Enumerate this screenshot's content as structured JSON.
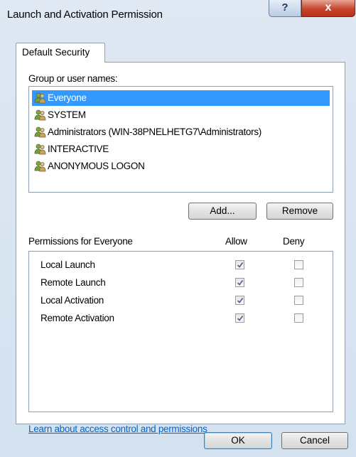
{
  "window": {
    "title": "Launch and Activation Permission",
    "help_label": "?",
    "close_label": "x"
  },
  "tab": {
    "label": "Default Security"
  },
  "users": {
    "label": "Group or user names:",
    "items": [
      {
        "name": "Everyone",
        "selected": true
      },
      {
        "name": "SYSTEM",
        "selected": false
      },
      {
        "name": "Administrators (WIN-38PNELHETG7\\Administrators)",
        "selected": false
      },
      {
        "name": "INTERACTIVE",
        "selected": false
      },
      {
        "name": "ANONYMOUS LOGON",
        "selected": false
      }
    ],
    "icon": "user-group-icon"
  },
  "buttons": {
    "add": "Add...",
    "remove": "Remove",
    "ok": "OK",
    "cancel": "Cancel"
  },
  "permissions": {
    "title": "Permissions for Everyone",
    "allow_header": "Allow",
    "deny_header": "Deny",
    "rows": [
      {
        "label": "Local Launch",
        "allow": true,
        "deny": false
      },
      {
        "label": "Remote Launch",
        "allow": true,
        "deny": false
      },
      {
        "label": "Local Activation",
        "allow": true,
        "deny": false
      },
      {
        "label": "Remote Activation",
        "allow": true,
        "deny": false
      }
    ]
  },
  "help_link": "Learn about access control and permissions"
}
